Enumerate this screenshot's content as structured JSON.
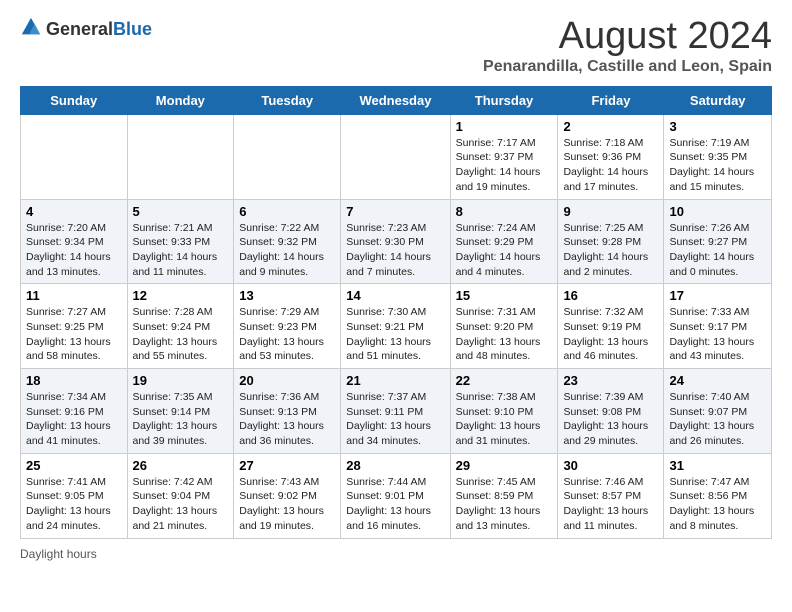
{
  "header": {
    "logo_general": "General",
    "logo_blue": "Blue",
    "title": "August 2024",
    "subtitle": "Penarandilla, Castille and Leon, Spain"
  },
  "columns": [
    "Sunday",
    "Monday",
    "Tuesday",
    "Wednesday",
    "Thursday",
    "Friday",
    "Saturday"
  ],
  "footer": {
    "daylight_label": "Daylight hours"
  },
  "weeks": [
    {
      "rowClass": "row-white",
      "days": [
        {
          "num": "",
          "info": ""
        },
        {
          "num": "",
          "info": ""
        },
        {
          "num": "",
          "info": ""
        },
        {
          "num": "",
          "info": ""
        },
        {
          "num": "1",
          "info": "Sunrise: 7:17 AM\nSunset: 9:37 PM\nDaylight: 14 hours\nand 19 minutes."
        },
        {
          "num": "2",
          "info": "Sunrise: 7:18 AM\nSunset: 9:36 PM\nDaylight: 14 hours\nand 17 minutes."
        },
        {
          "num": "3",
          "info": "Sunrise: 7:19 AM\nSunset: 9:35 PM\nDaylight: 14 hours\nand 15 minutes."
        }
      ]
    },
    {
      "rowClass": "row-gray",
      "days": [
        {
          "num": "4",
          "info": "Sunrise: 7:20 AM\nSunset: 9:34 PM\nDaylight: 14 hours\nand 13 minutes."
        },
        {
          "num": "5",
          "info": "Sunrise: 7:21 AM\nSunset: 9:33 PM\nDaylight: 14 hours\nand 11 minutes."
        },
        {
          "num": "6",
          "info": "Sunrise: 7:22 AM\nSunset: 9:32 PM\nDaylight: 14 hours\nand 9 minutes."
        },
        {
          "num": "7",
          "info": "Sunrise: 7:23 AM\nSunset: 9:30 PM\nDaylight: 14 hours\nand 7 minutes."
        },
        {
          "num": "8",
          "info": "Sunrise: 7:24 AM\nSunset: 9:29 PM\nDaylight: 14 hours\nand 4 minutes."
        },
        {
          "num": "9",
          "info": "Sunrise: 7:25 AM\nSunset: 9:28 PM\nDaylight: 14 hours\nand 2 minutes."
        },
        {
          "num": "10",
          "info": "Sunrise: 7:26 AM\nSunset: 9:27 PM\nDaylight: 14 hours\nand 0 minutes."
        }
      ]
    },
    {
      "rowClass": "row-white",
      "days": [
        {
          "num": "11",
          "info": "Sunrise: 7:27 AM\nSunset: 9:25 PM\nDaylight: 13 hours\nand 58 minutes."
        },
        {
          "num": "12",
          "info": "Sunrise: 7:28 AM\nSunset: 9:24 PM\nDaylight: 13 hours\nand 55 minutes."
        },
        {
          "num": "13",
          "info": "Sunrise: 7:29 AM\nSunset: 9:23 PM\nDaylight: 13 hours\nand 53 minutes."
        },
        {
          "num": "14",
          "info": "Sunrise: 7:30 AM\nSunset: 9:21 PM\nDaylight: 13 hours\nand 51 minutes."
        },
        {
          "num": "15",
          "info": "Sunrise: 7:31 AM\nSunset: 9:20 PM\nDaylight: 13 hours\nand 48 minutes."
        },
        {
          "num": "16",
          "info": "Sunrise: 7:32 AM\nSunset: 9:19 PM\nDaylight: 13 hours\nand 46 minutes."
        },
        {
          "num": "17",
          "info": "Sunrise: 7:33 AM\nSunset: 9:17 PM\nDaylight: 13 hours\nand 43 minutes."
        }
      ]
    },
    {
      "rowClass": "row-gray",
      "days": [
        {
          "num": "18",
          "info": "Sunrise: 7:34 AM\nSunset: 9:16 PM\nDaylight: 13 hours\nand 41 minutes."
        },
        {
          "num": "19",
          "info": "Sunrise: 7:35 AM\nSunset: 9:14 PM\nDaylight: 13 hours\nand 39 minutes."
        },
        {
          "num": "20",
          "info": "Sunrise: 7:36 AM\nSunset: 9:13 PM\nDaylight: 13 hours\nand 36 minutes."
        },
        {
          "num": "21",
          "info": "Sunrise: 7:37 AM\nSunset: 9:11 PM\nDaylight: 13 hours\nand 34 minutes."
        },
        {
          "num": "22",
          "info": "Sunrise: 7:38 AM\nSunset: 9:10 PM\nDaylight: 13 hours\nand 31 minutes."
        },
        {
          "num": "23",
          "info": "Sunrise: 7:39 AM\nSunset: 9:08 PM\nDaylight: 13 hours\nand 29 minutes."
        },
        {
          "num": "24",
          "info": "Sunrise: 7:40 AM\nSunset: 9:07 PM\nDaylight: 13 hours\nand 26 minutes."
        }
      ]
    },
    {
      "rowClass": "row-white",
      "days": [
        {
          "num": "25",
          "info": "Sunrise: 7:41 AM\nSunset: 9:05 PM\nDaylight: 13 hours\nand 24 minutes."
        },
        {
          "num": "26",
          "info": "Sunrise: 7:42 AM\nSunset: 9:04 PM\nDaylight: 13 hours\nand 21 minutes."
        },
        {
          "num": "27",
          "info": "Sunrise: 7:43 AM\nSunset: 9:02 PM\nDaylight: 13 hours\nand 19 minutes."
        },
        {
          "num": "28",
          "info": "Sunrise: 7:44 AM\nSunset: 9:01 PM\nDaylight: 13 hours\nand 16 minutes."
        },
        {
          "num": "29",
          "info": "Sunrise: 7:45 AM\nSunset: 8:59 PM\nDaylight: 13 hours\nand 13 minutes."
        },
        {
          "num": "30",
          "info": "Sunrise: 7:46 AM\nSunset: 8:57 PM\nDaylight: 13 hours\nand 11 minutes."
        },
        {
          "num": "31",
          "info": "Sunrise: 7:47 AM\nSunset: 8:56 PM\nDaylight: 13 hours\nand 8 minutes."
        }
      ]
    }
  ]
}
